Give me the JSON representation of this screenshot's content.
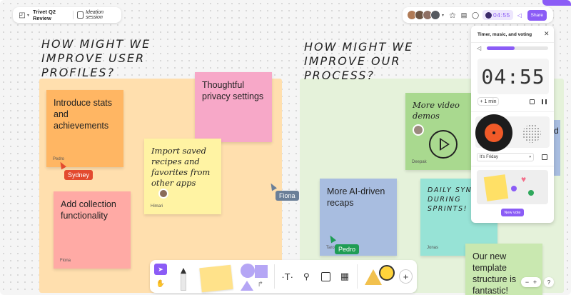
{
  "topbar": {
    "app_icon": "figjam-logo-icon",
    "file_name": "Trivet Q2 Review",
    "page_label": "Ideation session",
    "timer": "04:55",
    "share_label": "Share"
  },
  "sections": [
    {
      "title": "HOW MIGHT WE IMPROVE USER PROFILES?"
    },
    {
      "title": "HOW MIGHT WE IMPROVE OUR PROCESS?"
    }
  ],
  "notes": [
    {
      "text": "Introduce stats and achievements",
      "author": "Pedro"
    },
    {
      "text": "Thoughtful privacy settings",
      "author": ""
    },
    {
      "text": "Import saved recipes and favorites from other apps",
      "author": "Himari"
    },
    {
      "text": "Add collection functionality",
      "author": "Fiona"
    },
    {
      "text": "More video demos",
      "author": "Deepak"
    },
    {
      "text": "More AI-driven recaps",
      "author": "Taro"
    },
    {
      "text": "DAILY SYNC DURING SPRINTS!",
      "author": "Jonas"
    },
    {
      "text": "Our new template structure is fantastic!",
      "author": ""
    }
  ],
  "cursors": [
    {
      "name": "Sydney",
      "color": "#e34a2f"
    },
    {
      "name": "Fiona",
      "color": "#6b7f98"
    },
    {
      "name": "Pedro",
      "color": "#1f9d55"
    }
  ],
  "panel": {
    "title": "Timer, music, and voting",
    "timer": "04:55",
    "add_min": "+ 1 min",
    "track": "It's Friday",
    "new_vote": "New vote",
    "side_letter": "d"
  },
  "toolbar": {
    "tools": [
      "select",
      "pen",
      "sticky",
      "shapes",
      "text",
      "stamp",
      "section",
      "table",
      "stickers",
      "more"
    ]
  },
  "zoom": {
    "minus": "−",
    "plus": "+",
    "help": "?"
  },
  "colors": {
    "accent": "#8b5cf6",
    "orange_section": "#ffdca8",
    "green_section": "#e4f1d8"
  }
}
